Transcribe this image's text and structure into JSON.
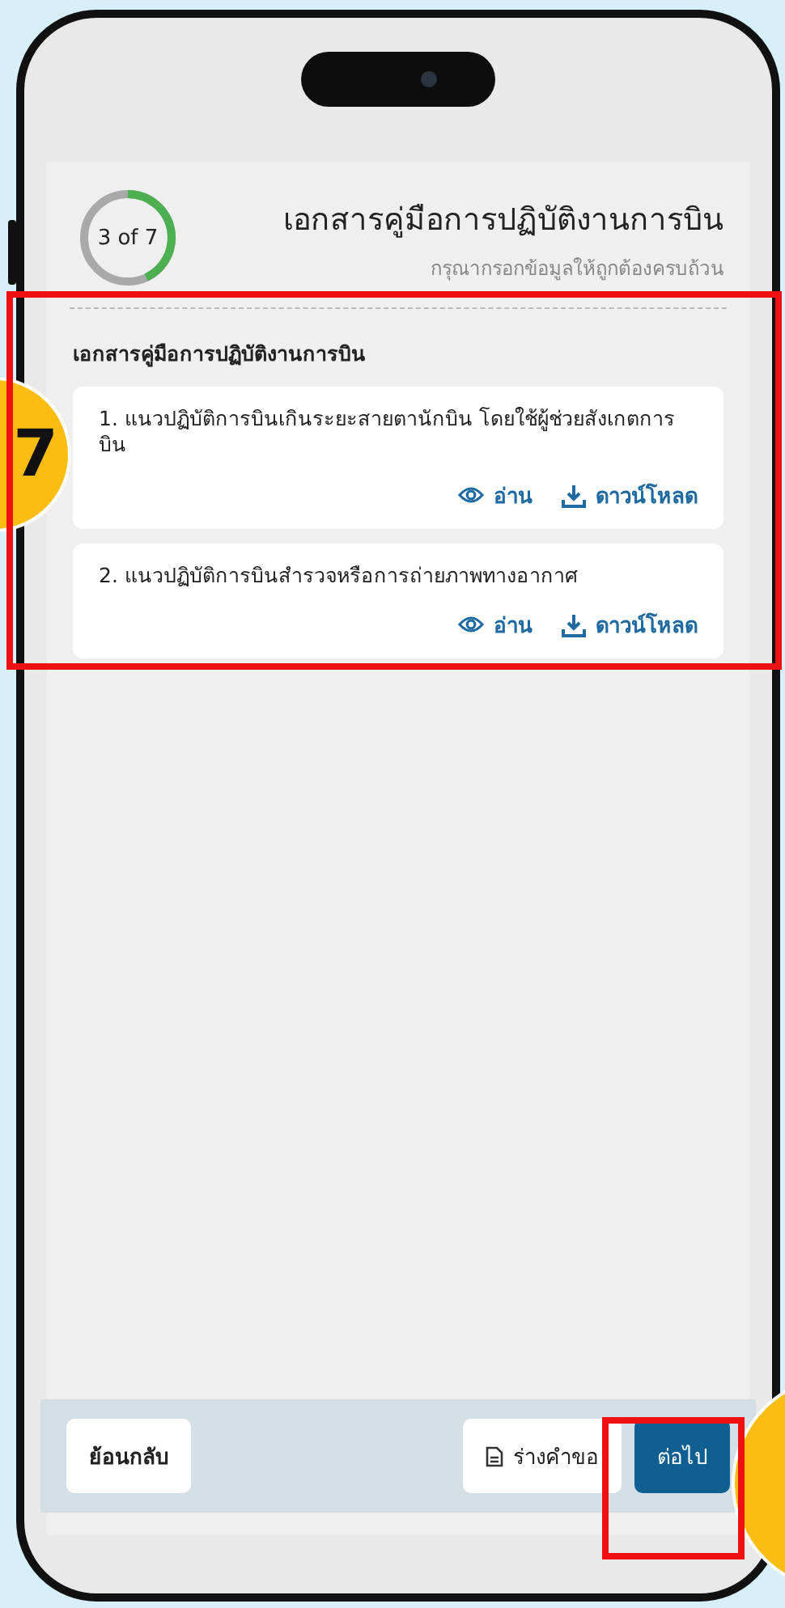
{
  "header": {
    "progress": {
      "label": "3 of 7",
      "level": 0.43
    },
    "title": "เอกสารคู่มือการปฏิบัติงานการบิน",
    "subtitle": "กรุณากรอกข้อมูลให้ถูกต้องครบถ้วน"
  },
  "section": {
    "title": "เอกสารคู่มือการปฏิบัติงานการบิน",
    "documents": [
      {
        "name": "1. แนวปฏิบัติการบินเกินระยะสายตานักบิน โดยใช้ผู้ช่วยสังเกตการบิน",
        "read": "อ่าน",
        "download": "ดาวน์โหลด"
      },
      {
        "name": "2. แนวปฏิบัติการบินสำรวจหรือการถ่ายภาพทางอากาศ",
        "read": "อ่าน",
        "download": "ดาวน์โหลด"
      }
    ]
  },
  "footer": {
    "back": "ย้อนกลับ",
    "draft": "ร่างคำขอ",
    "next": "ต่อไป"
  },
  "annotations": [
    {
      "kind": "badge",
      "label": "7"
    },
    {
      "kind": "badge"
    },
    {
      "kind": "frame"
    },
    {
      "kind": "frame"
    }
  ]
}
